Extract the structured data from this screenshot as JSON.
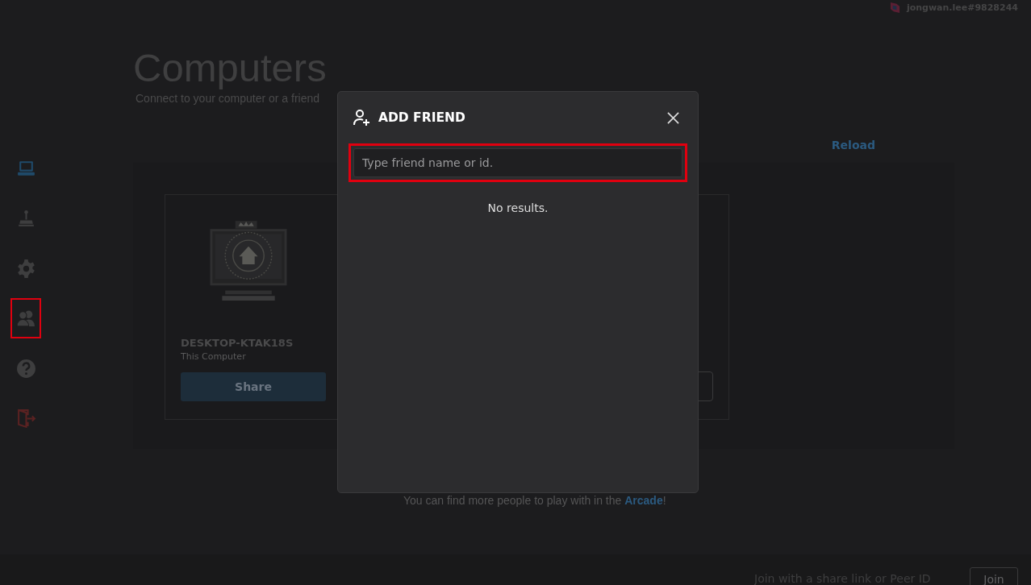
{
  "user": {
    "name": "jongwan.lee#9828244"
  },
  "sidebar": {
    "items": [
      {
        "kind": "computer",
        "selected": true,
        "highlighted": false
      },
      {
        "kind": "joystick",
        "selected": false,
        "highlighted": false
      },
      {
        "kind": "gear",
        "selected": false,
        "highlighted": false
      },
      {
        "kind": "people",
        "selected": false,
        "highlighted": true
      },
      {
        "kind": "help",
        "selected": false,
        "highlighted": false
      },
      {
        "kind": "logout",
        "selected": false,
        "highlighted": false
      }
    ]
  },
  "page": {
    "title": "Computers",
    "subtitle": "Connect to your computer or a friend",
    "reload": "Reload"
  },
  "computers": [
    {
      "name": "DESKTOP-KTAK18S",
      "caption": "This Computer",
      "button": "Share"
    }
  ],
  "footer_note": {
    "text": "You can find more people to play with in the ",
    "link": "Arcade",
    "end": "!"
  },
  "join_bar": {
    "placeholder": "Join with a share link or Peer ID",
    "button": "Join"
  },
  "dialog": {
    "title": "ADD FRIEND",
    "search": {
      "placeholder": "Type friend name or id.",
      "highlighted": true
    },
    "empty": "No results."
  }
}
